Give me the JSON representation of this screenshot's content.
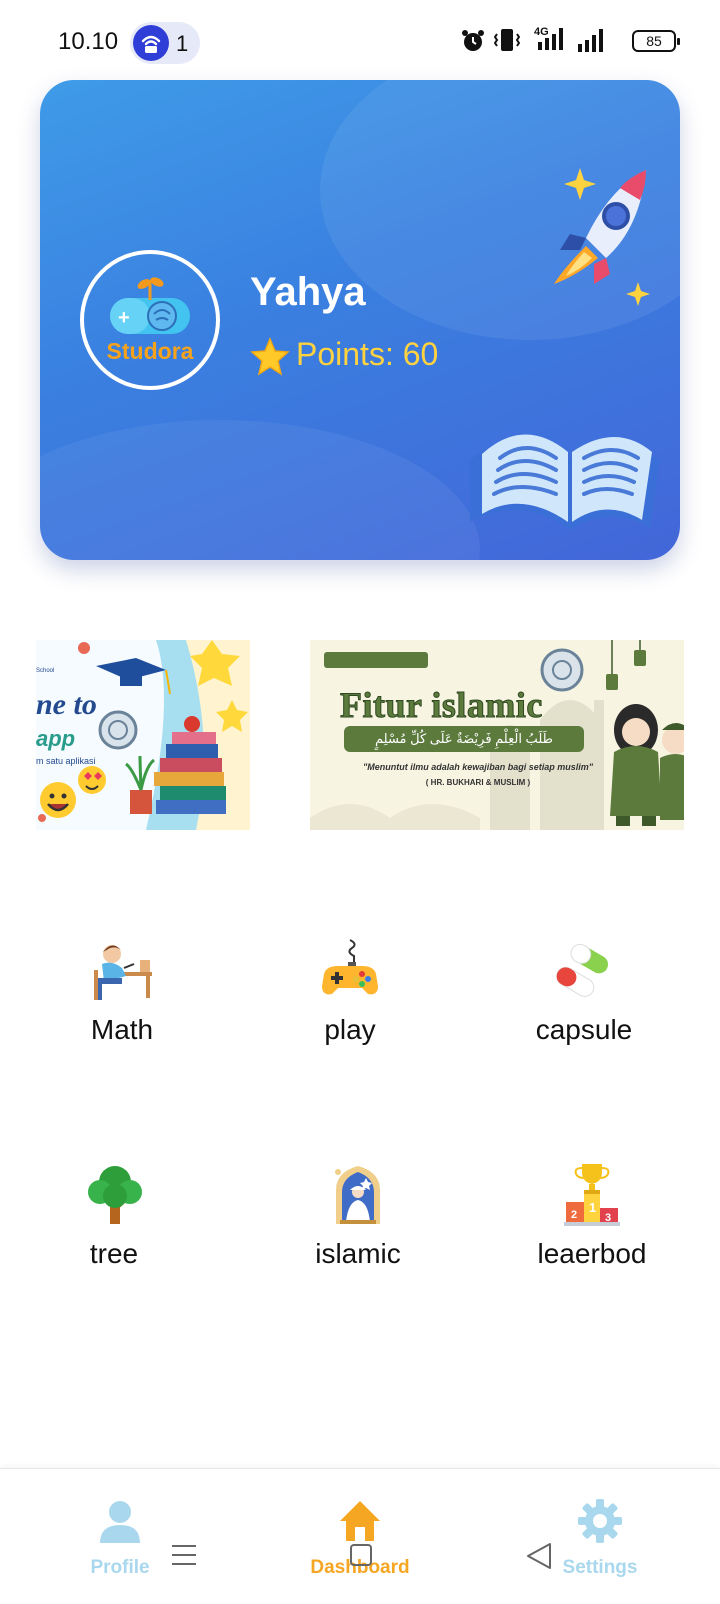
{
  "status_bar": {
    "time": "10.10",
    "hotspot_count": "1",
    "battery": "85",
    "icons": [
      "hotspot-icon",
      "alarm-icon",
      "vibrate-icon",
      "signal-4g-icon",
      "signal-icon",
      "battery-icon"
    ]
  },
  "profile_card": {
    "app_brand": "Studora",
    "user_name": "Yahya",
    "points_text": "Points: 60",
    "icons": [
      "studora-logo",
      "star-icon",
      "rocket-icon",
      "open-book-icon"
    ]
  },
  "banners": {
    "welcome": {
      "school": "School",
      "line1": "ne to",
      "line2": "app",
      "line3": "m satu aplikasi"
    },
    "islamic": {
      "title": "Fitur islamic",
      "arabic": "طَلَبُ الْعِلْمِ فَرِيْضَةٌ عَلَى كُلِّ مُسْلِمٍ",
      "quote": "\"Menuntut ilmu adalah kewajiban bagi setiap muslim\"",
      "source": "( HR. BUKHARI & MUSLIM )"
    }
  },
  "menu": [
    {
      "label": "Math",
      "icon": "student-desk-icon"
    },
    {
      "label": "play",
      "icon": "gamepad-icon"
    },
    {
      "label": "capsule",
      "icon": "capsule-icon"
    },
    {
      "label": "tree",
      "icon": "tree-icon"
    },
    {
      "label": "islamic",
      "icon": "mosque-prayer-icon"
    },
    {
      "label": "leaerbod",
      "icon": "podium-trophy-icon"
    }
  ],
  "bottom_nav": [
    {
      "label": "Profile",
      "icon": "person-icon",
      "color": "#a9d8ee",
      "active": false
    },
    {
      "label": "Dashboard",
      "icon": "home-icon",
      "color": "#f5a623",
      "active": true
    },
    {
      "label": "Settings",
      "icon": "gear-icon",
      "color": "#a9d8ee",
      "active": false
    }
  ],
  "colors": {
    "card_gradient_start": "#3f9be8",
    "card_gradient_end": "#4366d8",
    "points": "#ffd23f",
    "brand_orange": "#f7a21b",
    "nav_active": "#f5a623",
    "nav_inactive": "#a9d8ee"
  }
}
